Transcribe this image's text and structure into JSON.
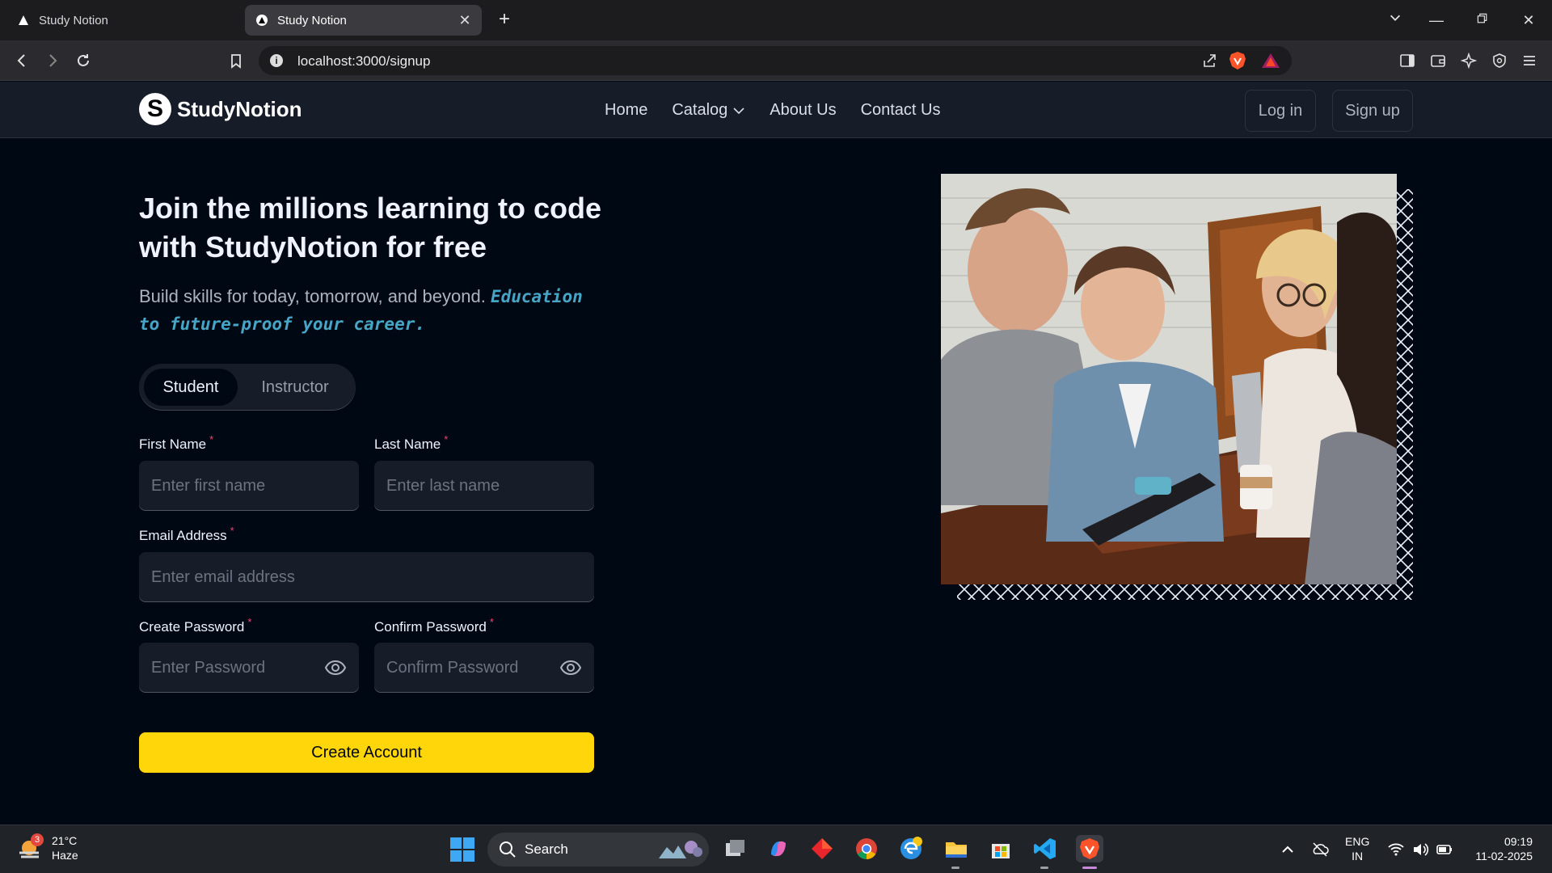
{
  "browser": {
    "tabs": [
      {
        "title": "Study Notion",
        "active": false
      },
      {
        "title": "Study Notion",
        "active": true
      }
    ],
    "url": "localhost:3000/signup"
  },
  "site": {
    "brand": "StudyNotion",
    "brand_mark": "S",
    "nav": [
      "Home",
      "Catalog",
      "About Us",
      "Contact Us"
    ],
    "login_label": "Log in",
    "signup_label": "Sign up"
  },
  "signup": {
    "heading": "Join the millions learning to code with StudyNotion for free",
    "subtitle": "Build skills for today, tomorrow, and beyond.",
    "subtitle_highlight": "Education to future-proof your career.",
    "roles": [
      "Student",
      "Instructor"
    ],
    "selected_role": "Student",
    "first_name_label": "First Name",
    "first_name_placeholder": "Enter first name",
    "last_name_label": "Last Name",
    "last_name_placeholder": "Enter last name",
    "email_label": "Email Address",
    "email_placeholder": "Enter email address",
    "password_label": "Create Password",
    "password_placeholder": "Enter Password",
    "confirm_label": "Confirm Password",
    "confirm_placeholder": "Confirm Password",
    "required_mark": "*",
    "submit_label": "Create Account"
  },
  "colors": {
    "background": "#000814",
    "accent_yellow": "#ffd60a",
    "highlight_blue": "#47a5c5",
    "required_pink": "#ef476f"
  },
  "taskbar": {
    "weather_temp": "21°C",
    "weather_desc": "Haze",
    "weather_badge": "3",
    "search_label": "Search",
    "lang_top": "ENG",
    "lang_bottom": "IN",
    "time": "09:19",
    "date": "11-02-2025"
  }
}
